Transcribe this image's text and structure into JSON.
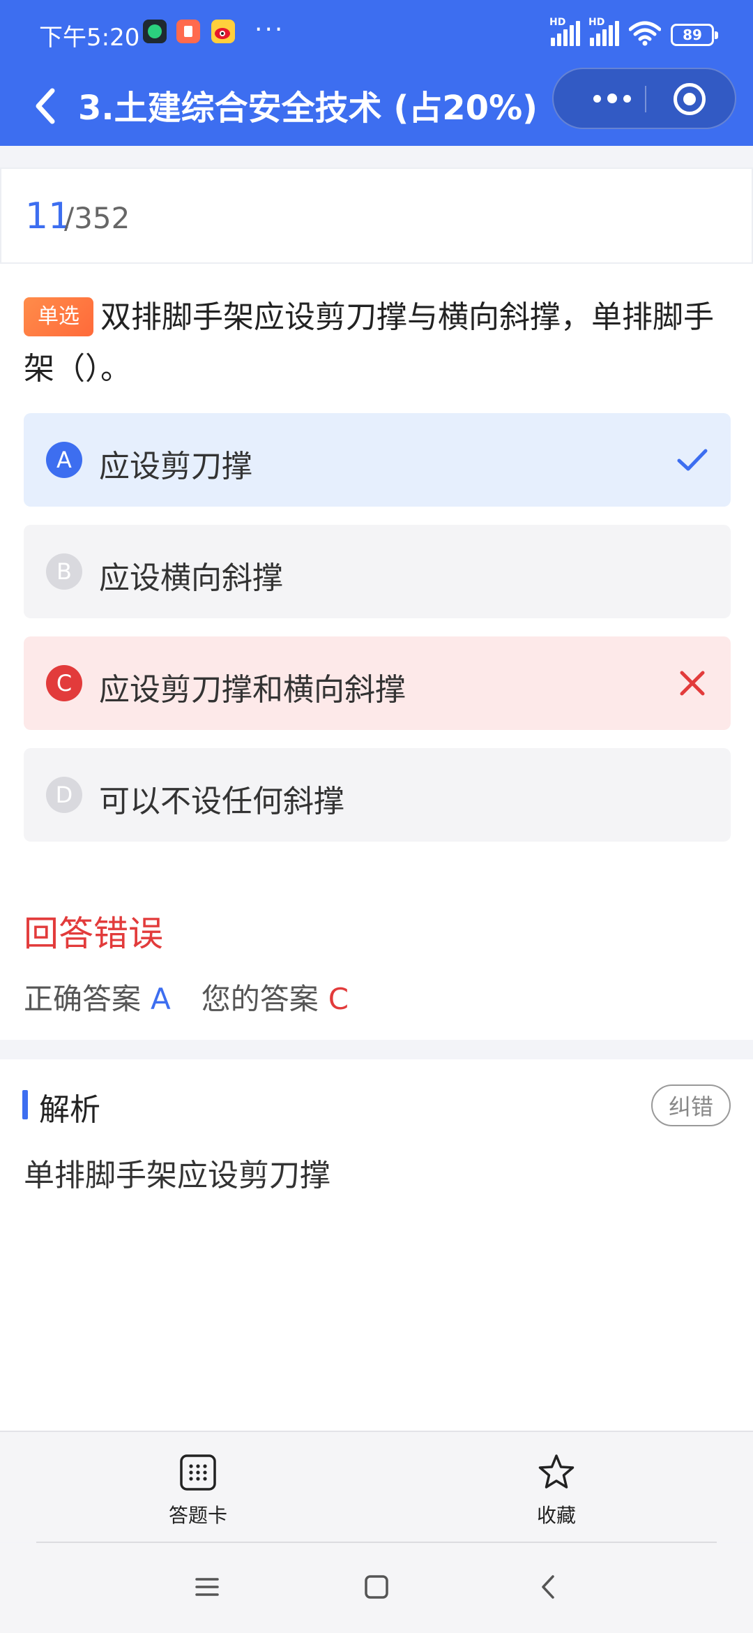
{
  "status_bar": {
    "time": "下午5:20",
    "more": "···",
    "hd1": "HD",
    "hd2": "HD",
    "battery": "89"
  },
  "nav": {
    "title": "3.土建综合安全技术 (占20%)"
  },
  "counter": {
    "current": "11",
    "total": "/352"
  },
  "question": {
    "tag": "单选",
    "text": "双排脚手架应设剪刀撑与横向斜撑，单排脚手架（）。",
    "options": [
      {
        "letter": "A",
        "text": "应设剪刀撑",
        "state": "correct"
      },
      {
        "letter": "B",
        "text": "应设横向斜撑",
        "state": "normal"
      },
      {
        "letter": "C",
        "text": "应设剪刀撑和横向斜撑",
        "state": "wrong"
      },
      {
        "letter": "D",
        "text": "可以不设任何斜撑",
        "state": "normal"
      }
    ]
  },
  "result": {
    "title": "回答错误",
    "correct_label": "正确答案",
    "correct_value": "A",
    "yours_label": "您的答案",
    "yours_value": "C"
  },
  "analysis": {
    "label": "解析",
    "report_button": "纠错",
    "content": "单排脚手架应设剪刀撑"
  },
  "toolbar": {
    "answer_card": "答题卡",
    "favorite": "收藏"
  },
  "colors": {
    "primary": "#3d6ef0",
    "error": "#e23b3b",
    "tag": "#ff7a40"
  }
}
